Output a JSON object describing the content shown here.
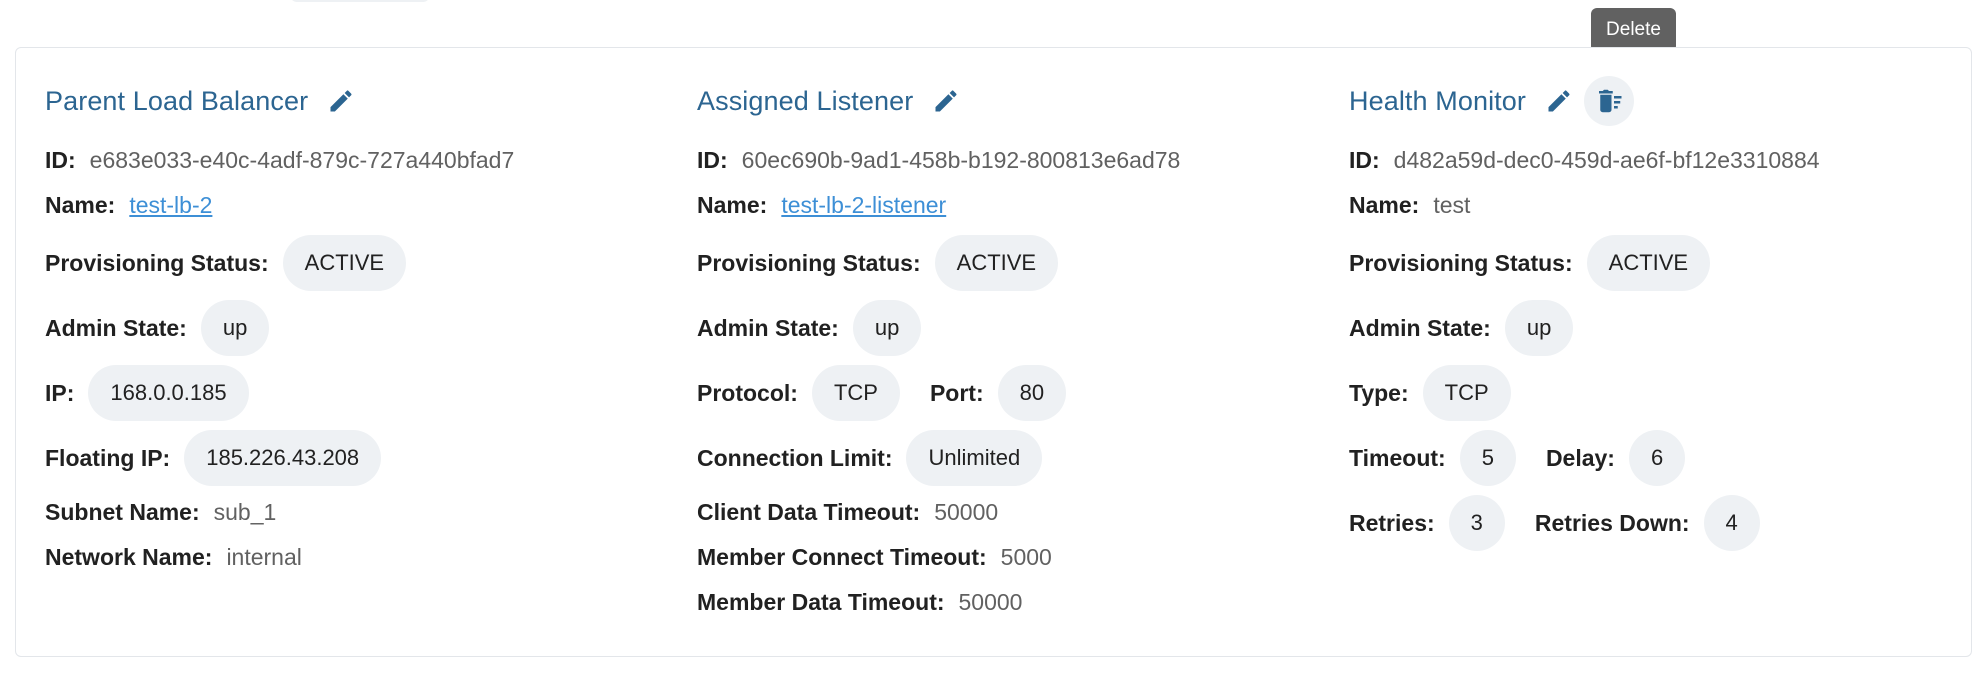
{
  "tooltip": "Delete",
  "load_balancer": {
    "title": "Parent Load Balancer",
    "id_label": "ID:",
    "id": "e683e033-e40c-4adf-879c-727a440bfad7",
    "name_label": "Name:",
    "name": "test-lb-2",
    "provisioning_status_label": "Provisioning Status:",
    "provisioning_status": "ACTIVE",
    "admin_state_label": "Admin State:",
    "admin_state": "up",
    "ip_label": "IP:",
    "ip": "168.0.0.185",
    "floating_ip_label": "Floating IP:",
    "floating_ip": "185.226.43.208",
    "subnet_name_label": "Subnet Name:",
    "subnet_name": "sub_1",
    "network_name_label": "Network Name:",
    "network_name": "internal"
  },
  "listener": {
    "title": "Assigned Listener",
    "id_label": "ID:",
    "id": "60ec690b-9ad1-458b-b192-800813e6ad78",
    "name_label": "Name:",
    "name": "test-lb-2-listener",
    "provisioning_status_label": "Provisioning Status:",
    "provisioning_status": "ACTIVE",
    "admin_state_label": "Admin State:",
    "admin_state": "up",
    "protocol_label": "Protocol:",
    "protocol": "TCP",
    "port_label": "Port:",
    "port": "80",
    "connection_limit_label": "Connection Limit:",
    "connection_limit": "Unlimited",
    "client_data_timeout_label": "Client Data Timeout:",
    "client_data_timeout": "50000",
    "member_connect_timeout_label": "Member Connect Timeout:",
    "member_connect_timeout": "5000",
    "member_data_timeout_label": "Member Data Timeout:",
    "member_data_timeout": "50000"
  },
  "health_monitor": {
    "title": "Health Monitor",
    "id_label": "ID:",
    "id": "d482a59d-dec0-459d-ae6f-bf12e3310884",
    "name_label": "Name:",
    "name": "test",
    "provisioning_status_label": "Provisioning Status:",
    "provisioning_status": "ACTIVE",
    "admin_state_label": "Admin State:",
    "admin_state": "up",
    "type_label": "Type:",
    "type": "TCP",
    "timeout_label": "Timeout:",
    "timeout": "5",
    "delay_label": "Delay:",
    "delay": "6",
    "retries_label": "Retries:",
    "retries": "3",
    "retries_down_label": "Retries Down:",
    "retries_down": "4"
  },
  "icons": {
    "edit": "pencil-edit-icon",
    "delete": "trash-delete-icon"
  },
  "colors": {
    "title": "#2c6591",
    "link": "#3d8fd6",
    "chip_bg": "#eef1f4",
    "tooltip_bg": "#616161"
  }
}
